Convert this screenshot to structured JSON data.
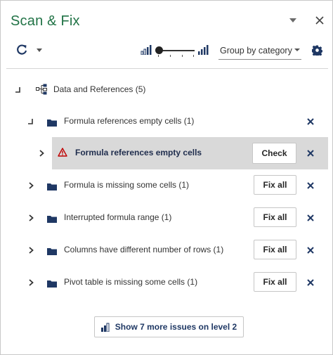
{
  "header": {
    "title": "Scan & Fix"
  },
  "toolbar": {
    "group_by_value": "Group by category"
  },
  "tree": {
    "root": {
      "label": "Data and References (5)"
    },
    "group_empty": {
      "label": "Formula references empty cells (1)"
    },
    "issue_selected": {
      "label": "Formula references empty cells",
      "button": "Check"
    },
    "items": [
      {
        "label": "Formula is missing some cells (1)",
        "button": "Fix all"
      },
      {
        "label": "Interrupted formula range (1)",
        "button": "Fix all"
      },
      {
        "label": "Columns have different number of rows (1)",
        "button": "Fix all"
      },
      {
        "label": "Pivot table is missing some cells (1)",
        "button": "Fix all"
      }
    ]
  },
  "footer": {
    "more_issues_label": "Show 7 more issues on level 2"
  },
  "colors": {
    "title": "#217346",
    "selected_row": "#d9d9d9",
    "warning": "#c00000",
    "folder": "#1f3864",
    "more_button_text": "#1f3864"
  },
  "icons": {
    "dropdown": "chevron-down-icon",
    "close": "close-icon",
    "refresh": "refresh-icon",
    "level_low": "bars-low-icon",
    "level_high": "bars-high-icon",
    "settings": "gear-icon",
    "category": "hierarchy-icon",
    "folder": "folder-icon",
    "warning": "warning-icon",
    "level_chart": "bar-chart-icon"
  }
}
